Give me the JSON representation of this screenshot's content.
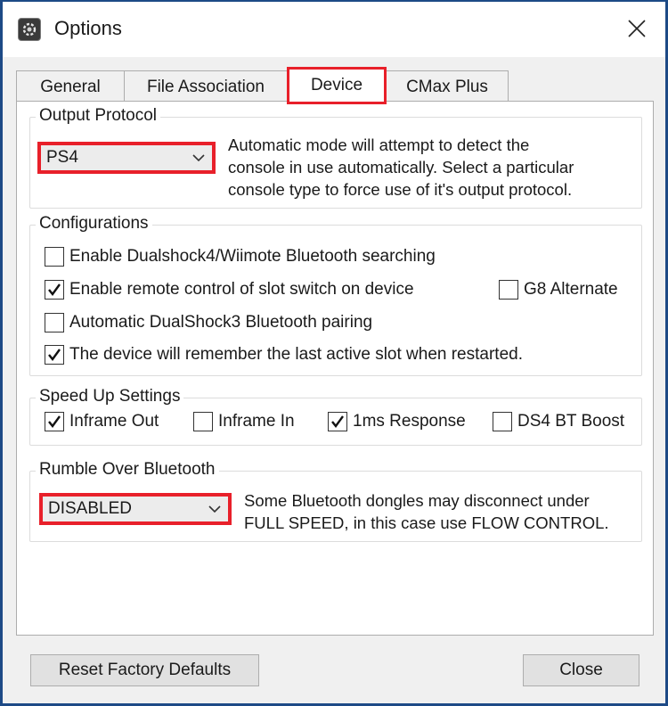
{
  "window": {
    "title": "Options",
    "app_icon": "gear-icon",
    "close_icon": "close-icon"
  },
  "tabs": [
    {
      "label": "General",
      "active": false
    },
    {
      "label": "File Association",
      "active": false
    },
    {
      "label": "Device",
      "active": true,
      "highlighted": true
    },
    {
      "label": "CMax Plus",
      "active": false
    }
  ],
  "output_protocol": {
    "group_label": "Output Protocol",
    "selected": "PS4",
    "highlighted": true,
    "description": "Automatic mode will attempt to detect the console in use automatically. Select a particular console type to force use of it's output protocol.",
    "description_lines": [
      "Automatic mode will attempt to detect the",
      "console in use automatically. Select a particular",
      "console type to force use of it's output protocol."
    ]
  },
  "configurations": {
    "group_label": "Configurations",
    "items": [
      {
        "label": "Enable Dualshock4/Wiimote Bluetooth searching",
        "checked": false
      },
      {
        "label": "Enable remote control of slot switch on device",
        "checked": true
      },
      {
        "label": "G8 Alternate",
        "checked": false
      },
      {
        "label": "Automatic DualShock3 Bluetooth pairing",
        "checked": false
      },
      {
        "label": "The device will remember the last active slot when restarted.",
        "checked": true
      }
    ]
  },
  "speed_up": {
    "group_label": "Speed Up Settings",
    "items": [
      {
        "label": "Inframe Out",
        "checked": true
      },
      {
        "label": "Inframe In",
        "checked": false
      },
      {
        "label": "1ms Response",
        "checked": true
      },
      {
        "label": "DS4 BT Boost",
        "checked": false
      }
    ]
  },
  "rumble": {
    "group_label": "Rumble Over Bluetooth",
    "selected": "DISABLED",
    "highlighted": true,
    "description_lines": [
      "Some Bluetooth dongles may disconnect under",
      "FULL SPEED, in this case use FLOW CONTROL."
    ]
  },
  "footer": {
    "reset_label": "Reset Factory Defaults",
    "close_label": "Close"
  },
  "colors": {
    "highlight": "#e8202a",
    "window_border": "#1d4a86"
  }
}
